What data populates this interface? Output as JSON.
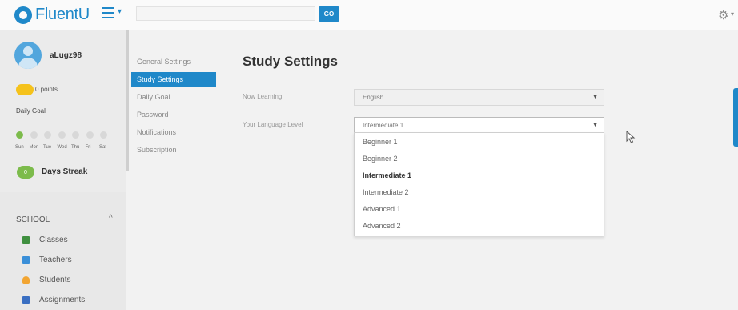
{
  "header": {
    "logo_text": "FluentU",
    "search_placeholder": "",
    "go_label": "GO",
    "menu_icon": "hamburger-menu-icon",
    "settings_icon": "gear-icon",
    "brand_color": "#1f88c9"
  },
  "sidebar": {
    "username": "aLugz98",
    "points": "0 points",
    "daily_goal": "Daily Goal",
    "days": [
      "Sun",
      "Mon",
      "Tue",
      "Wed",
      "Thu",
      "Fri",
      "Sat"
    ],
    "active_days": [
      true,
      false,
      false,
      false,
      false,
      false,
      false
    ],
    "streak_count": "0",
    "streak_label": "Days Streak",
    "school_header": "SCHOOL",
    "school_items": [
      {
        "label": "Classes",
        "icon": "classes-icon"
      },
      {
        "label": "Teachers",
        "icon": "teachers-icon"
      },
      {
        "label": "Students",
        "icon": "students-icon"
      },
      {
        "label": "Assignments",
        "icon": "assignments-icon"
      }
    ]
  },
  "settings_nav": {
    "items": [
      {
        "label": "General Settings",
        "active": false
      },
      {
        "label": "Study Settings",
        "active": true
      },
      {
        "label": "Daily Goal",
        "active": false
      },
      {
        "label": "Password",
        "active": false
      },
      {
        "label": "Notifications",
        "active": false
      },
      {
        "label": "Subscription",
        "active": false
      }
    ],
    "active_color": "#1f88c9"
  },
  "main": {
    "title": "Study Settings",
    "now_learning_label": "Now Learning",
    "now_learning_value": "English",
    "level_label": "Your Language Level",
    "level_value": "Intermediate 1",
    "level_options": [
      "Beginner 1",
      "Beginner 2",
      "Intermediate 1",
      "Intermediate 2",
      "Advanced 1",
      "Advanced 2"
    ],
    "level_selected_index": 2
  }
}
